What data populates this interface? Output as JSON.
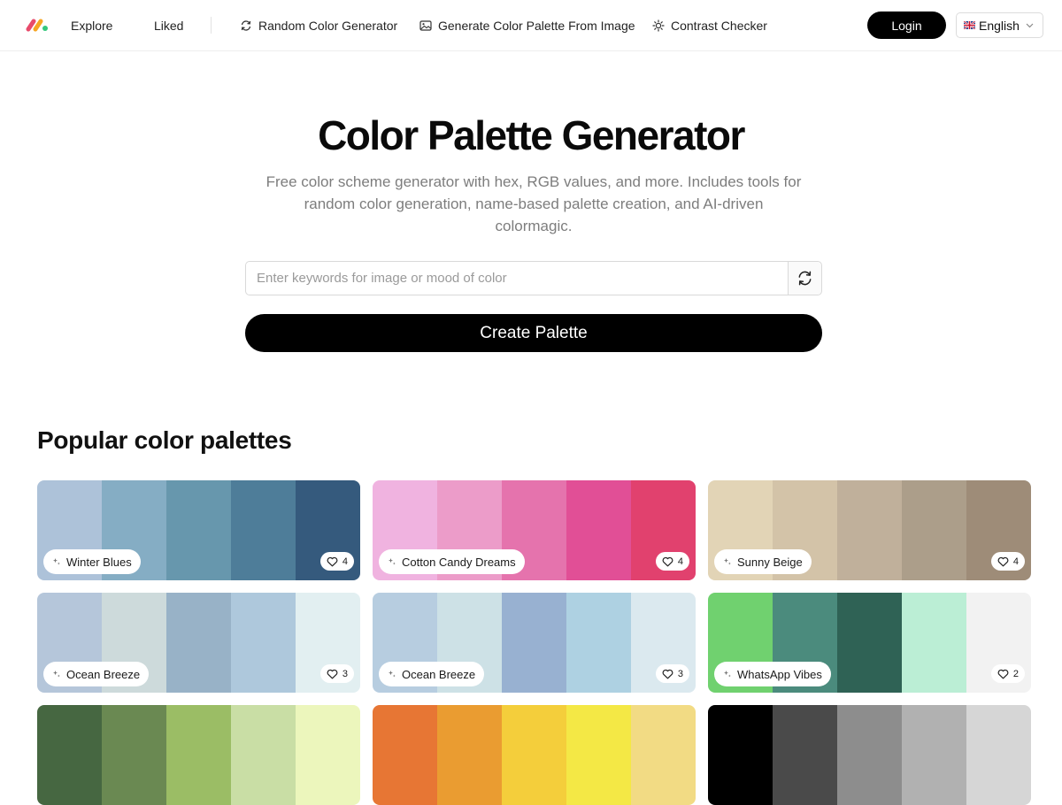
{
  "header": {
    "nav": [
      {
        "label": "Explore",
        "icon": ""
      },
      {
        "label": "Liked",
        "icon": ""
      },
      {
        "label": "Random Color Generator",
        "icon": "refresh-icon"
      },
      {
        "label": "Generate Color Palette From Image",
        "icon": "image-icon"
      },
      {
        "label": "Contrast Checker",
        "icon": "sun-icon"
      }
    ],
    "login_label": "Login",
    "language": "English"
  },
  "hero": {
    "title": "Color Palette Generator",
    "subtitle": "Free color scheme generator with hex, RGB values, and more. Includes tools for random color generation, name-based palette creation, and AI-driven colormagic.",
    "search_placeholder": "Enter keywords for image or mood of color",
    "search_value": "",
    "create_label": "Create Palette"
  },
  "popular": {
    "title": "Popular color palettes",
    "palettes": [
      {
        "name": "Winter Blues",
        "likes": "4",
        "colors": [
          "#adc2d9",
          "#85adc4",
          "#6797ad",
          "#4e7d99",
          "#355a7d"
        ]
      },
      {
        "name": "Cotton Candy Dreams",
        "likes": "4",
        "colors": [
          "#f0b3e0",
          "#ec9cc9",
          "#e573ad",
          "#e14f96",
          "#e1416e"
        ]
      },
      {
        "name": "Sunny Beige",
        "likes": "4",
        "colors": [
          "#e2d4b6",
          "#d3c3a8",
          "#c0b09b",
          "#ac9e8a",
          "#9e8c78"
        ]
      },
      {
        "name": "Ocean Breeze",
        "likes": "3",
        "colors": [
          "#b5c6da",
          "#cddadb",
          "#98b2c7",
          "#aec8dc",
          "#e2eff1"
        ]
      },
      {
        "name": "Ocean Breeze",
        "likes": "3",
        "colors": [
          "#b7cde0",
          "#cde1e6",
          "#98b1d1",
          "#aed1e2",
          "#dbe9ef"
        ]
      },
      {
        "name": "WhatsApp Vibes",
        "likes": "2",
        "colors": [
          "#70d16f",
          "#4b8b7d",
          "#2f6255",
          "#bbeed5",
          "#f2f2f2"
        ]
      },
      {
        "name": "",
        "likes": "",
        "colors": [
          "#466741",
          "#6a8952",
          "#9bbd65",
          "#c9dea5",
          "#ecf6bc"
        ]
      },
      {
        "name": "",
        "likes": "",
        "colors": [
          "#e77634",
          "#ea9c31",
          "#f4ce3b",
          "#f4e845",
          "#f2db84"
        ]
      },
      {
        "name": "",
        "likes": "",
        "colors": [
          "#000000",
          "#4a4a4a",
          "#8d8d8d",
          "#b1b1b1",
          "#d6d6d6"
        ]
      }
    ]
  }
}
